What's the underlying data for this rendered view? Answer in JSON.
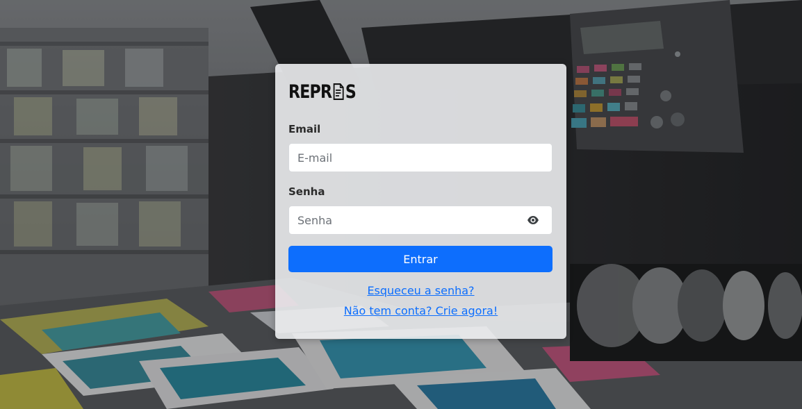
{
  "brand": {
    "logo_text_left": "REPR",
    "logo_icon": "document-icon",
    "logo_text_right": "S"
  },
  "form": {
    "email_label": "Email",
    "email_placeholder": "E-mail",
    "email_value": "",
    "password_label": "Senha",
    "password_placeholder": "Senha",
    "password_value": "",
    "password_toggle_icon": "eye-icon",
    "submit_label": "Entrar"
  },
  "links": {
    "forgot_password": "Esqueceu a senha?",
    "create_account": "Não tem conta? Crie agora!"
  },
  "colors": {
    "primary": "#0d6efd",
    "link": "#0d6efd",
    "card_bg": "#ecedef"
  }
}
